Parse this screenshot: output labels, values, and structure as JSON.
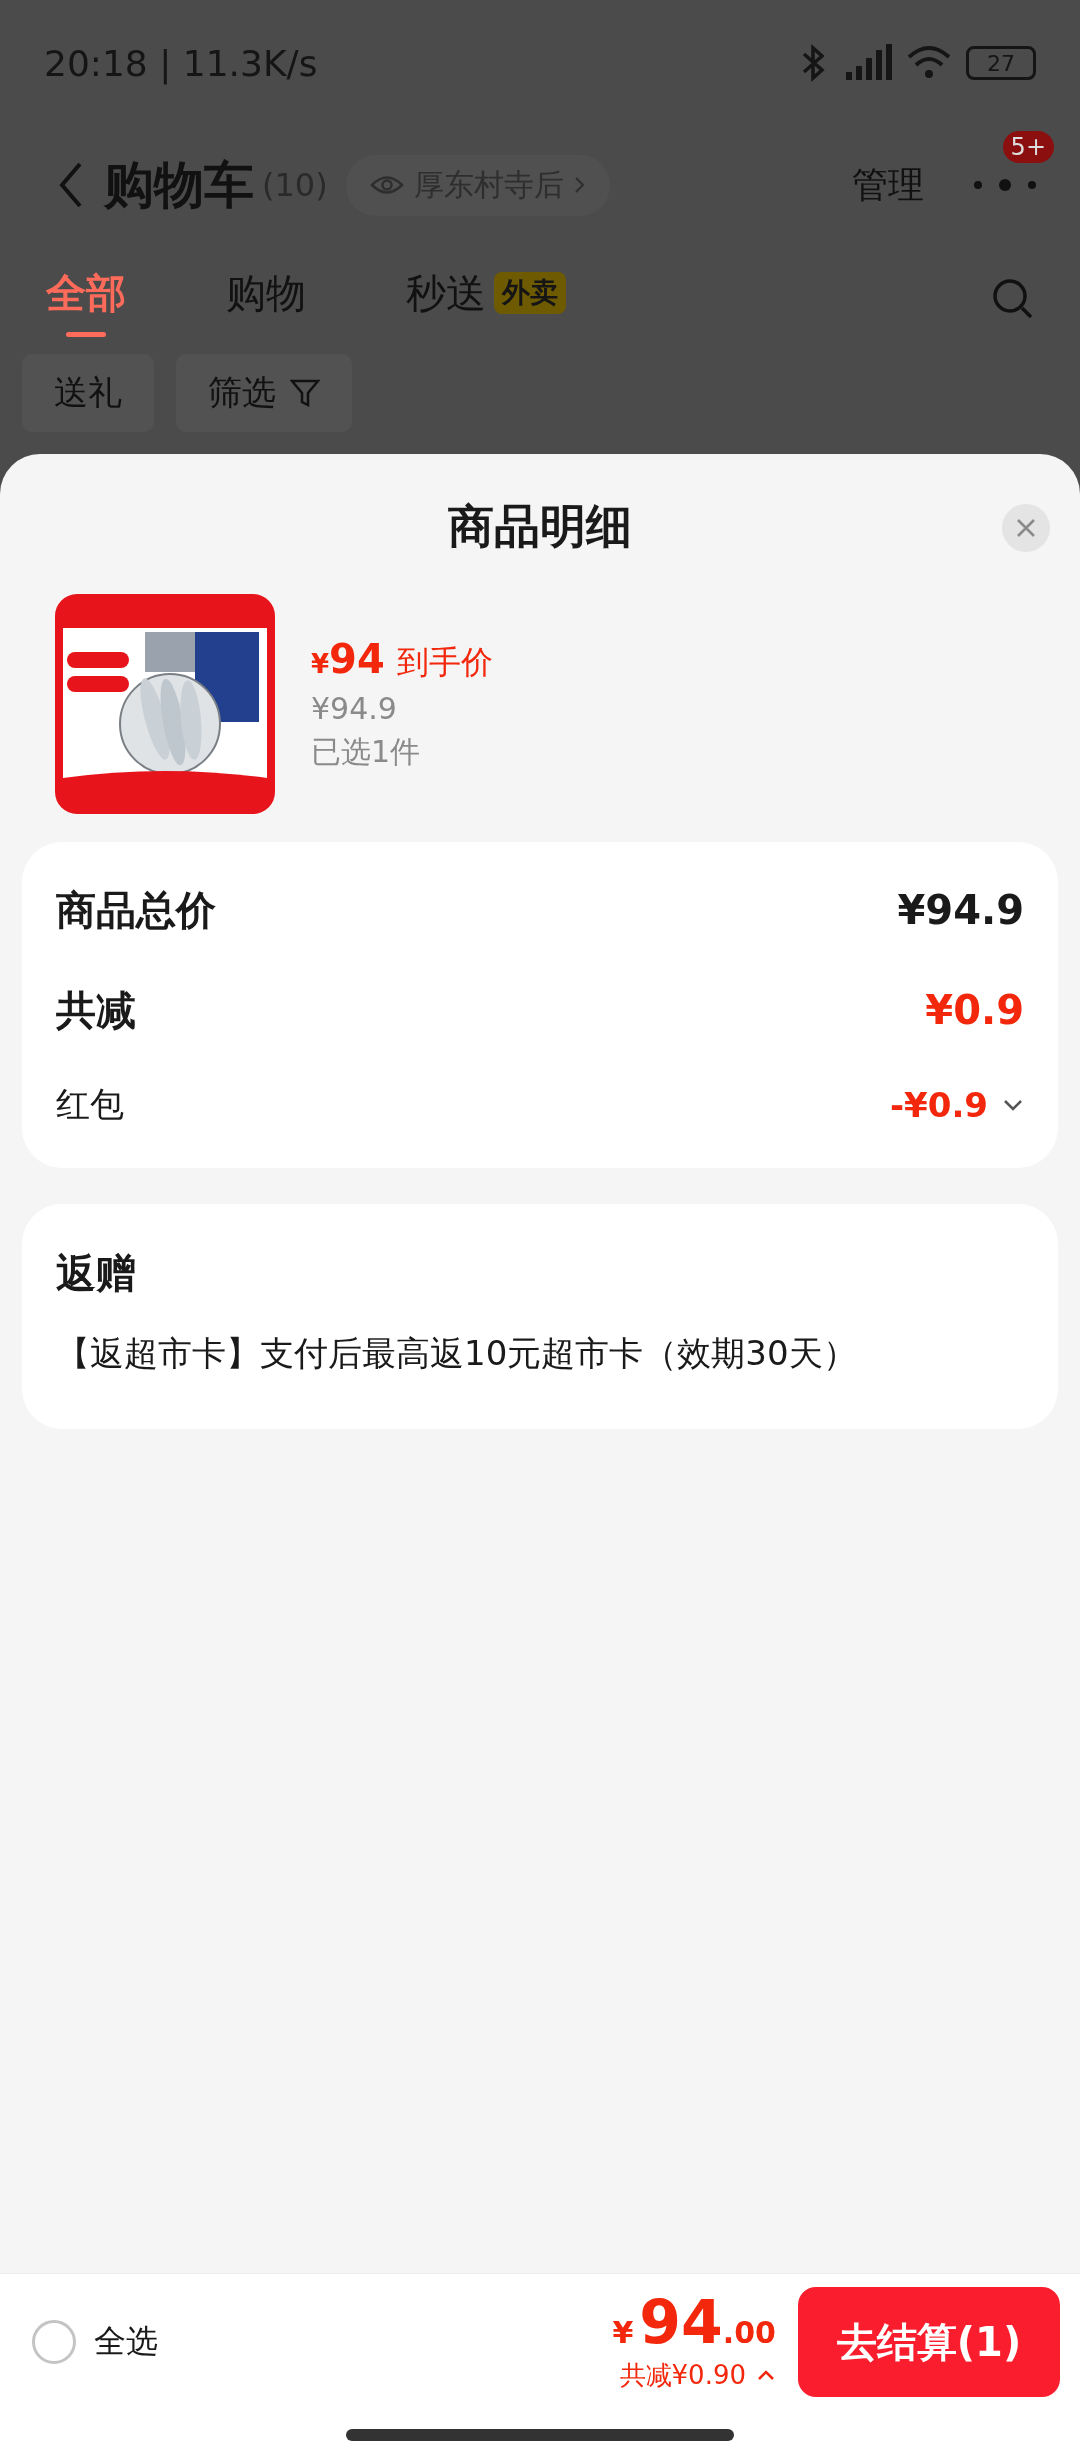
{
  "status_bar": {
    "time": "20:18 | 11.3K/s",
    "battery": "27"
  },
  "header": {
    "title": "购物车",
    "count": "(10)",
    "location": "厚东村寺后",
    "manage": "管理",
    "badge": "5+"
  },
  "tabs": [
    {
      "label": "全部",
      "selected": true
    },
    {
      "label": "购物",
      "selected": false
    },
    {
      "label": "秒送",
      "tag": "外卖",
      "selected": false
    }
  ],
  "chips": [
    {
      "label": "送礼",
      "kind": "plain"
    },
    {
      "label": "筛选",
      "kind": "filter"
    }
  ],
  "sheet": {
    "title": "商品明细",
    "product": {
      "kind": "picture",
      "currency": "¥",
      "price": "94",
      "price_label": "到手价",
      "original_price": "¥94.9",
      "selected_count": "已选1件"
    },
    "summary": [
      {
        "kind": "total",
        "label": "商品总价",
        "value": "¥94.9"
      },
      {
        "kind": "discount",
        "label": "共减",
        "value": "¥0.9"
      },
      {
        "kind": "detail",
        "label": "红包",
        "value": "-¥0.9"
      }
    ],
    "gift": {
      "title": "返赠",
      "text": "【返超市卡】支付后最高返10元超市卡（效期30天）"
    }
  },
  "footer": {
    "select_all": {
      "label": "全选",
      "checked": false
    },
    "currency": "¥",
    "total_int": "94",
    "total_dec": ".00",
    "savings": "共减¥0.90",
    "checkout": "去结算(1)"
  }
}
